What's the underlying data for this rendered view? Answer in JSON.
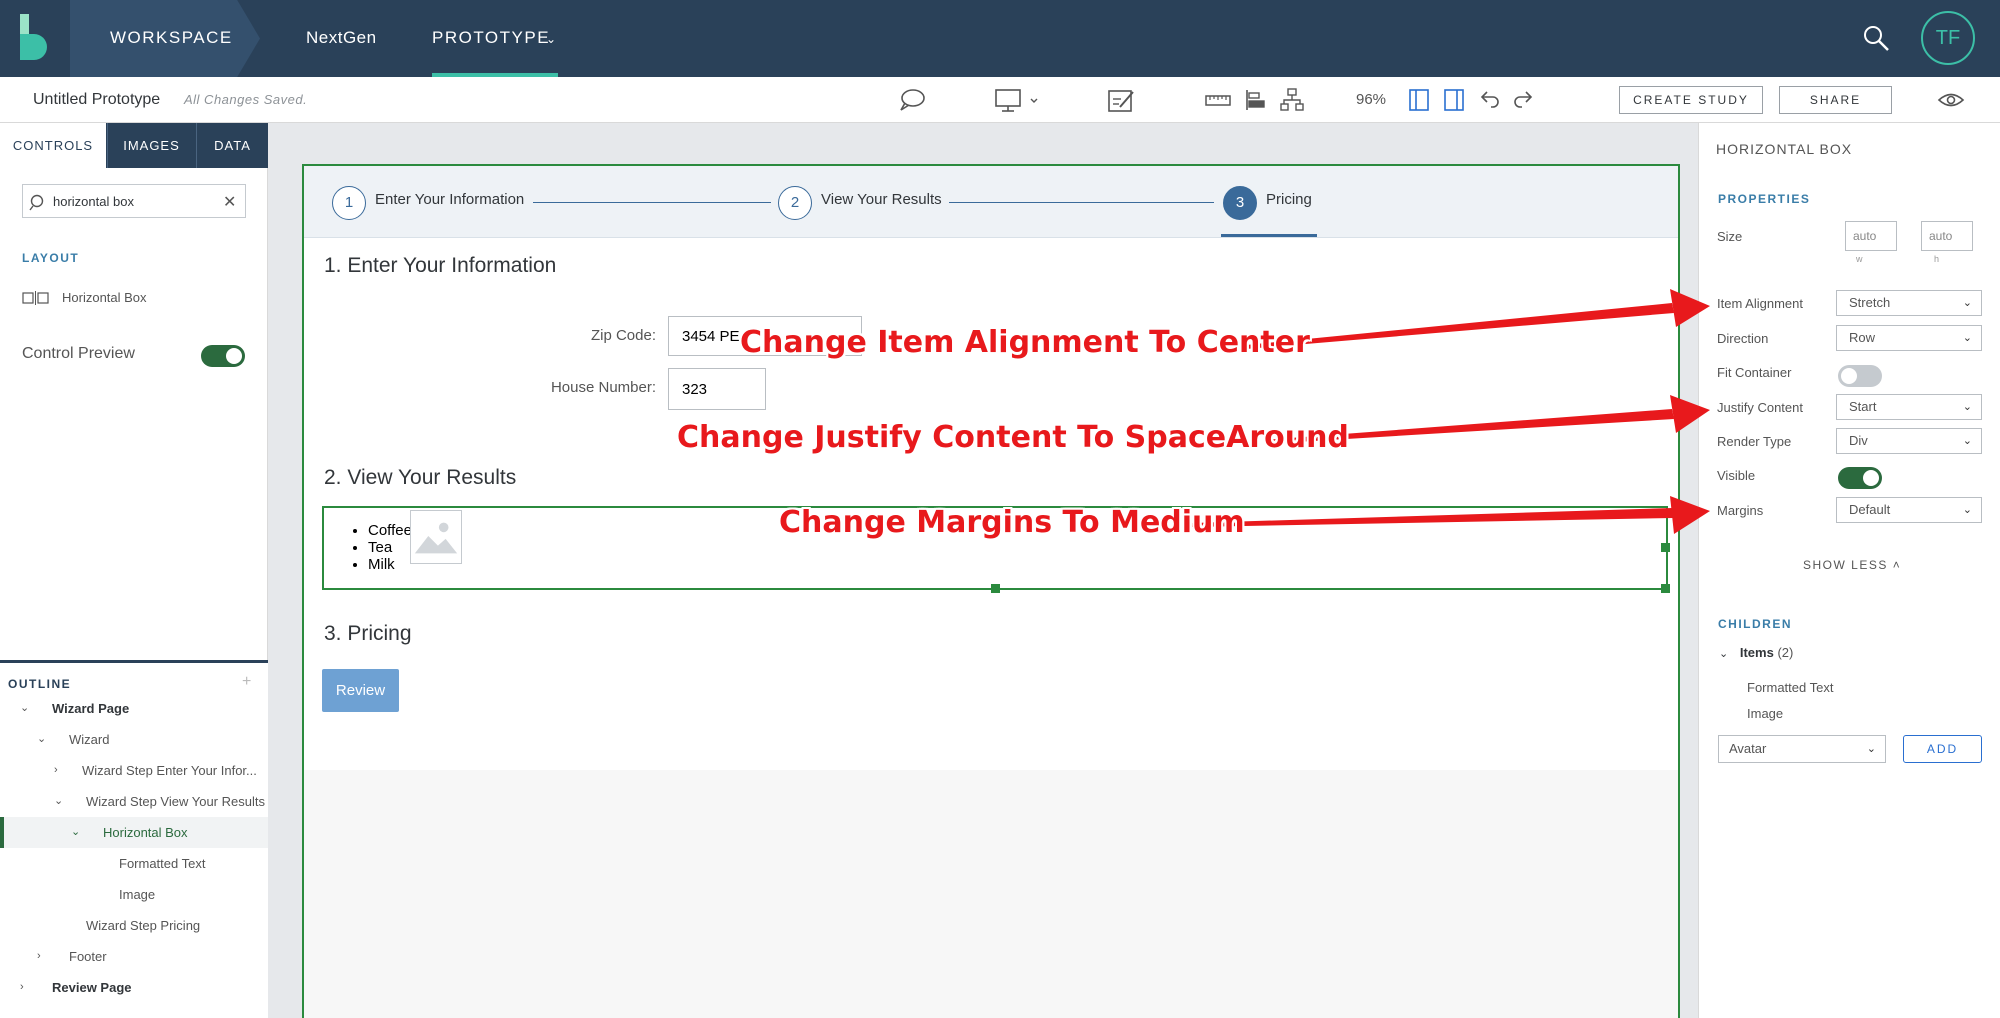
{
  "topnav": {
    "workspace": "WORKSPACE",
    "nextgen": "NextGen",
    "prototype": "PROTOTYPE",
    "avatar_initials": "TF",
    "colors": {
      "bar": "#2a4159",
      "accent": "#3cbfa7"
    }
  },
  "toolbar": {
    "prototype_name": "Untitled Prototype",
    "save_status": "All Changes Saved.",
    "zoom": "96%",
    "create_study": "CREATE STUDY",
    "share": "SHARE",
    "icons": [
      "comment-icon",
      "desktop-icon",
      "annotate-icon",
      "ruler-icon",
      "align-icon",
      "hierarchy-icon",
      "layout-left-icon",
      "layout-right-icon",
      "undo-icon",
      "redo-icon",
      "eye-icon"
    ]
  },
  "left": {
    "tabs": [
      "CONTROLS",
      "IMAGES",
      "DATA"
    ],
    "search_value": "horizontal box",
    "layout_heading": "LAYOUT",
    "control_item": "Horizontal Box",
    "preview_label": "Control Preview",
    "preview_on": true,
    "outline_heading": "OUTLINE",
    "outline": [
      {
        "label": "Wizard Page"
      },
      {
        "label": "Wizard"
      },
      {
        "label": "Wizard Step Enter Your Infor..."
      },
      {
        "label": "Wizard Step View Your Results"
      },
      {
        "label": "Horizontal Box"
      },
      {
        "label": "Formatted Text"
      },
      {
        "label": "Image"
      },
      {
        "label": "Wizard Step Pricing"
      },
      {
        "label": "Footer"
      },
      {
        "label": "Review Page"
      }
    ]
  },
  "canvas": {
    "steps": [
      {
        "num": "1",
        "label": "Enter Your Information"
      },
      {
        "num": "2",
        "label": "View Your Results"
      },
      {
        "num": "3",
        "label": "Pricing"
      }
    ],
    "section1": "1. Enter Your Information",
    "zip_label": "Zip Code:",
    "zip_value": "3454 PE",
    "house_label": "House Number:",
    "house_value": "323",
    "section2": "2. View Your Results",
    "list": [
      "Coffee",
      "Tea",
      "Milk"
    ],
    "section3": "3. Pricing",
    "review": "Review"
  },
  "right": {
    "title": "HORIZONTAL BOX",
    "properties_heading": "PROPERTIES",
    "size_label": "Size",
    "size_w": "auto",
    "size_h": "auto",
    "size_w_cap": "w",
    "size_h_cap": "h",
    "item_alignment_label": "Item Alignment",
    "item_alignment": "Stretch",
    "direction_label": "Direction",
    "direction": "Row",
    "fit_container_label": "Fit Container",
    "fit_container_on": false,
    "justify_content_label": "Justify Content",
    "justify_content": "Start",
    "render_type_label": "Render Type",
    "render_type": "Div",
    "visible_label": "Visible",
    "visible_on": true,
    "margins_label": "Margins",
    "margins": "Default",
    "show_less": "SHOW LESS",
    "children_heading": "CHILDREN",
    "items_label": "Items",
    "items_count": "(2)",
    "children": [
      "Formatted Text",
      "Image"
    ],
    "add_select": "Avatar",
    "add_button": "ADD"
  },
  "annotations": {
    "item_alignment": "Change Item Alignment To Center",
    "justify_content": "Change Justify Content To SpaceAround",
    "margins": "Change Margins To Medium",
    "color": "#e8191c"
  }
}
